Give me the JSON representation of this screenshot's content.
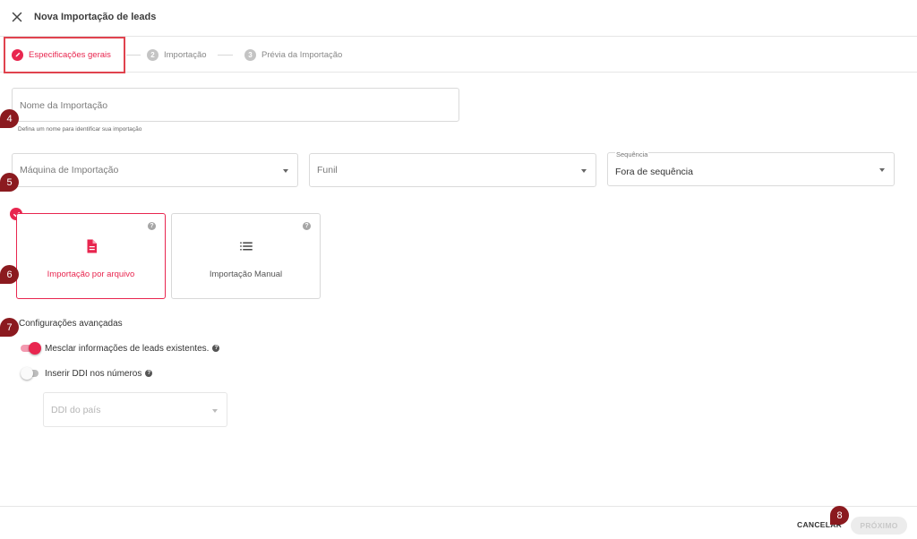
{
  "header": {
    "title": "Nova Importação de leads"
  },
  "stepper": {
    "steps": [
      {
        "label": "Especificações gerais",
        "number": ""
      },
      {
        "label": "Importação",
        "number": "2"
      },
      {
        "label": "Prévia da Importação",
        "number": "3"
      }
    ]
  },
  "form": {
    "import_name": {
      "placeholder": "Nome da Importação",
      "helper": "Defina um nome para identificar sua importação"
    },
    "machine": {
      "placeholder": "Máquina de Importação"
    },
    "funnel": {
      "placeholder": "Funil"
    },
    "sequence": {
      "label": "Sequência",
      "value": "Fora de sequência"
    }
  },
  "cards": [
    {
      "label": "Importação por arquivo",
      "icon": "file-icon",
      "selected": true
    },
    {
      "label": "Importação Manual",
      "icon": "list-icon",
      "selected": false
    }
  ],
  "advanced": {
    "title": "Configurações avançadas",
    "merge_label": "Mesclar informações de leads existentes.",
    "merge_on": true,
    "ddi_label": "Inserir DDI nos números",
    "ddi_on": false,
    "ddi_country": {
      "placeholder": "DDI do país"
    }
  },
  "markers": [
    "4",
    "5",
    "6",
    "7",
    "8"
  ],
  "footer": {
    "cancel_label": "CANCELAR",
    "next_label": "PRÓXIMO"
  },
  "colors": {
    "accent": "#e8264f",
    "highlight_box": "#e0434e",
    "marker": "#8b1a1f"
  }
}
